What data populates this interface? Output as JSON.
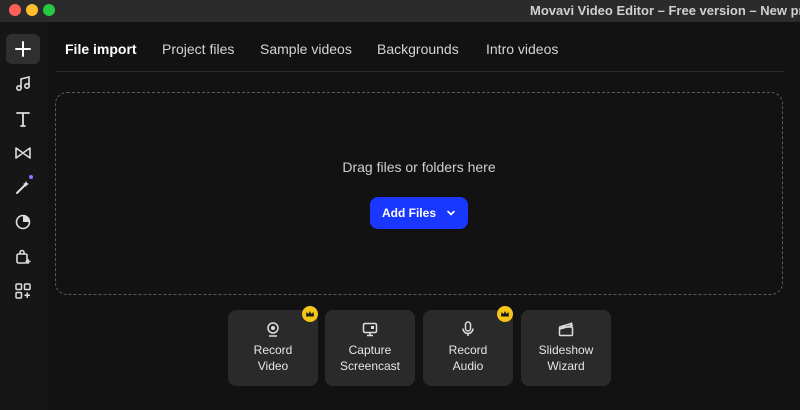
{
  "window": {
    "title": "Movavi Video Editor – Free version – New pr"
  },
  "sidebar": {
    "items": [
      {
        "name": "import",
        "icon": "plus-icon",
        "active": true
      },
      {
        "name": "music",
        "icon": "music-note-icon"
      },
      {
        "name": "titles",
        "icon": "text-icon"
      },
      {
        "name": "transitions",
        "icon": "transition-icon"
      },
      {
        "name": "effects",
        "icon": "magic-wand-icon"
      },
      {
        "name": "filters",
        "icon": "filter-icon"
      },
      {
        "name": "stickers",
        "icon": "shopping-bag-icon"
      },
      {
        "name": "more",
        "icon": "widgets-icon"
      }
    ]
  },
  "tabs": [
    {
      "label": "File import",
      "active": true
    },
    {
      "label": "Project files"
    },
    {
      "label": "Sample videos"
    },
    {
      "label": "Backgrounds"
    },
    {
      "label": "Intro videos"
    }
  ],
  "dropzone": {
    "text": "Drag files or folders here",
    "add_button": "Add Files"
  },
  "cards": [
    {
      "line1": "Record",
      "line2": "Video",
      "icon": "webcam-icon",
      "premium": true
    },
    {
      "line1": "Capture",
      "line2": "Screencast",
      "icon": "screen-capture-icon",
      "premium": false
    },
    {
      "line1": "Record",
      "line2": "Audio",
      "icon": "microphone-icon",
      "premium": true
    },
    {
      "line1": "Slideshow",
      "line2": "Wizard",
      "icon": "clapperboard-icon",
      "premium": false
    }
  ],
  "colors": {
    "accent": "#1a37ff",
    "premium": "#f5c518"
  }
}
